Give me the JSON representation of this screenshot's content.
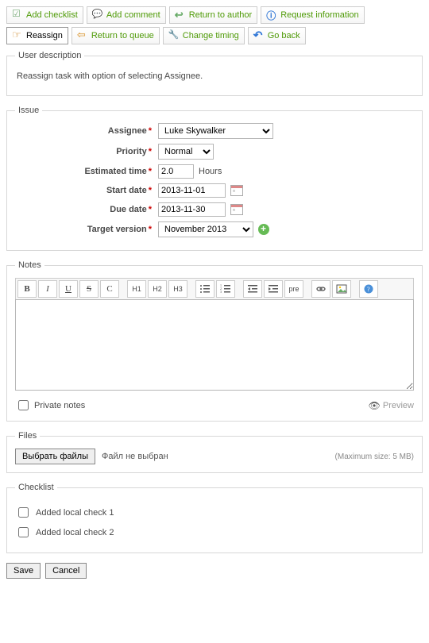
{
  "toolbar": {
    "add_checklist": "Add checklist",
    "add_comment": "Add comment",
    "return_author": "Return to author",
    "request_info": "Request information",
    "reassign": "Reassign",
    "return_queue": "Return to queue",
    "change_timing": "Change timing",
    "go_back": "Go back"
  },
  "user_description": {
    "legend": "User description",
    "text": "Reassign task with option of selecting Assignee."
  },
  "issue": {
    "legend": "Issue",
    "assignee_label": "Assignee",
    "assignee_value": "Luke Skywalker",
    "priority_label": "Priority",
    "priority_value": "Normal",
    "est_time_label": "Estimated time",
    "est_time_value": "2.0",
    "est_time_unit": "Hours",
    "start_date_label": "Start date",
    "start_date_value": "2013-11-01",
    "due_date_label": "Due date",
    "due_date_value": "2013-11-30",
    "target_ver_label": "Target version",
    "target_ver_value": "November 2013"
  },
  "notes": {
    "legend": "Notes",
    "buttons": {
      "bold": "B",
      "italic": "I",
      "underline": "U",
      "strike": "S",
      "code": "C",
      "h1": "H1",
      "h2": "H2",
      "h3": "H3",
      "pre": "pre"
    },
    "private_label": "Private notes",
    "preview_label": "Preview"
  },
  "files": {
    "legend": "Files",
    "choose_btn": "Выбрать файлы",
    "no_file": "Файл не выбран",
    "max_size": "(Maximum size: 5 MB)"
  },
  "checklist": {
    "legend": "Checklist",
    "items": [
      "Added local check 1",
      "Added local check 2"
    ]
  },
  "actions": {
    "save": "Save",
    "cancel": "Cancel"
  }
}
